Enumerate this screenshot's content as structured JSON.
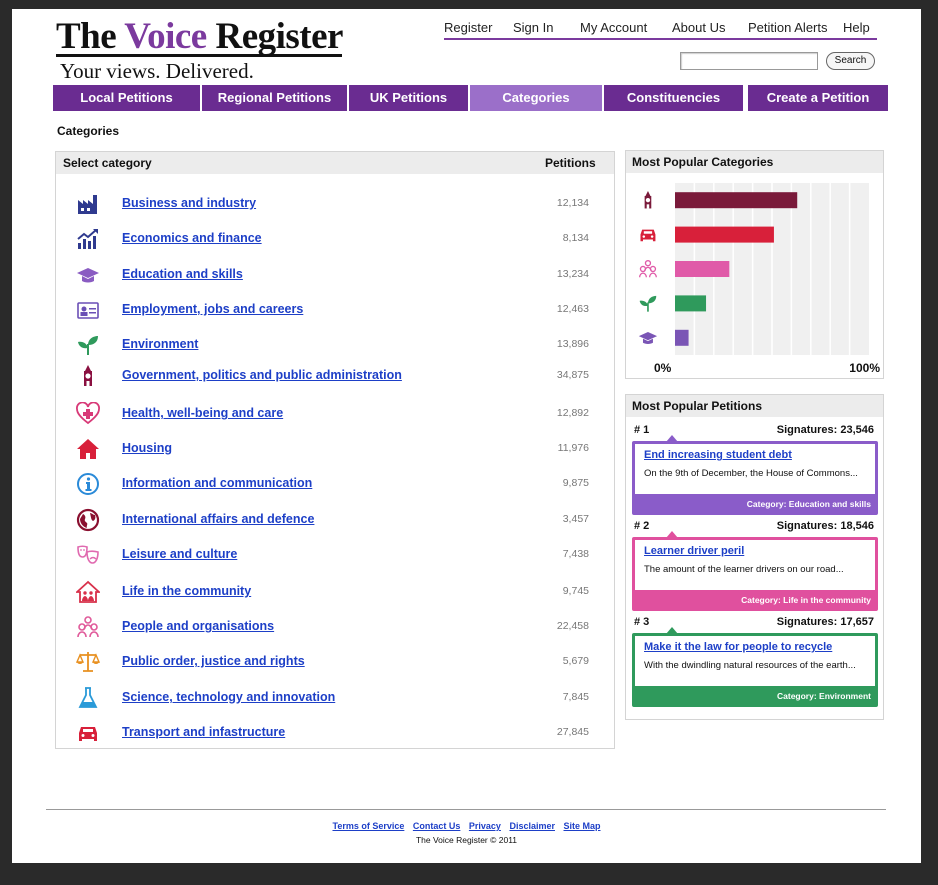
{
  "logo": {
    "title_pre": "The ",
    "title_accent": "Voice",
    "title_post": " Register",
    "tagline": "Your views. Delivered."
  },
  "toplinks": [
    "Register",
    "Sign In",
    "My Account",
    "About Us",
    "Petition Alerts",
    "Help"
  ],
  "search": {
    "button": "Search",
    "value": ""
  },
  "nav": [
    {
      "label": "Local Petitions",
      "active": false
    },
    {
      "label": "Regional Petitions",
      "active": false
    },
    {
      "label": "UK Petitions",
      "active": false
    },
    {
      "label": "Categories",
      "active": true
    },
    {
      "label": "Constituencies",
      "active": false
    },
    {
      "label": "Create a Petition",
      "active": false
    }
  ],
  "breadcrumb": "Categories",
  "category_panel": {
    "header_left": "Select category",
    "header_right": "Petitions",
    "rows": [
      {
        "label": "Business and industry",
        "count": "12,134",
        "icon": "factory-icon",
        "color": "#2f3a8f"
      },
      {
        "label": "Economics and finance",
        "count": "8,134",
        "icon": "growth-chart-icon",
        "color": "#2f3a8f"
      },
      {
        "label": "Education and skills",
        "count": "13,234",
        "icon": "graduation-cap-icon",
        "color": "#8a5cc2"
      },
      {
        "label": "Employment, jobs and careers",
        "count": "12,463",
        "icon": "id-card-icon",
        "color": "#6a4fb5"
      },
      {
        "label": "Environment",
        "count": "13,896",
        "icon": "plant-icon",
        "color": "#2f9a5c"
      },
      {
        "label": "Government, politics and public administration",
        "count": "34,875",
        "icon": "big-ben-icon",
        "color": "#8a1040"
      },
      {
        "label": "Health, well-being and care",
        "count": "12,892",
        "icon": "heart-cross-icon",
        "color": "#d83a78"
      },
      {
        "label": "Housing",
        "count": "11,976",
        "icon": "house-icon",
        "color": "#d8203a"
      },
      {
        "label": "Information and communication",
        "count": "9,875",
        "icon": "info-icon",
        "color": "#2a8ad8"
      },
      {
        "label": "International affairs and defence",
        "count": "3,457",
        "icon": "globe-icon",
        "color": "#8a1030"
      },
      {
        "label": "Leisure and culture",
        "count": "7,438",
        "icon": "theatre-masks-icon",
        "color": "#e06ab0"
      },
      {
        "label": "Life in the community",
        "count": "9,745",
        "icon": "community-house-icon",
        "color": "#d8304a"
      },
      {
        "label": "People and organisations",
        "count": "22,458",
        "icon": "people-icon",
        "color": "#e05a9a"
      },
      {
        "label": "Public order, justice and rights",
        "count": "5,679",
        "icon": "scales-icon",
        "color": "#e89020"
      },
      {
        "label": "Science, technology and innovation",
        "count": "7,845",
        "icon": "flask-icon",
        "color": "#2a9ad8"
      },
      {
        "label": "Transport and infastructure",
        "count": "27,845",
        "icon": "car-icon",
        "color": "#d8203a"
      }
    ]
  },
  "popular_categories": {
    "title": "Most Popular Categories",
    "chart_data": {
      "type": "bar",
      "orientation": "horizontal",
      "categories": [
        "Government, politics and public administration",
        "Transport and infastructure",
        "People and organisations",
        "Environment",
        "Education and skills"
      ],
      "icons": [
        "big-ben-icon",
        "car-icon",
        "people-icon",
        "plant-icon",
        "graduation-cap-icon"
      ],
      "values": [
        63,
        51,
        28,
        16,
        7
      ],
      "colors": [
        "#7a1a3a",
        "#d8203a",
        "#e05aa8",
        "#2f9a5c",
        "#7a55b5"
      ],
      "xlim": [
        0,
        100
      ],
      "xtick_labels": [
        "0%",
        "100%"
      ],
      "grid": true
    }
  },
  "popular_petitions": {
    "title": "Most Popular Petitions",
    "items": [
      {
        "rank": "# 1",
        "signatures": "Signatures: 23,546",
        "title": "End increasing student debt",
        "desc": "On the 9th of December, the House of Commons...",
        "category": "Category: Education and skills",
        "color": "#8a5cc9"
      },
      {
        "rank": "# 2",
        "signatures": "Signatures: 18,546",
        "title": "Learner driver peril",
        "desc": "The amount of the learner drivers on our road...",
        "category": "Category: Life in the community",
        "color": "#e0509e"
      },
      {
        "rank": "# 3",
        "signatures": "Signatures: 17,657",
        "title": "Make it the law for people to recycle",
        "desc": "With the dwindling natural resources of the earth...",
        "category": "Category: Environment",
        "color": "#2f9a5c"
      }
    ]
  },
  "footer": {
    "links": [
      "Terms of Service",
      "Contact Us",
      "Privacy",
      "Disclaimer",
      "Site Map"
    ],
    "copyright": "The Voice Register © 2011"
  }
}
